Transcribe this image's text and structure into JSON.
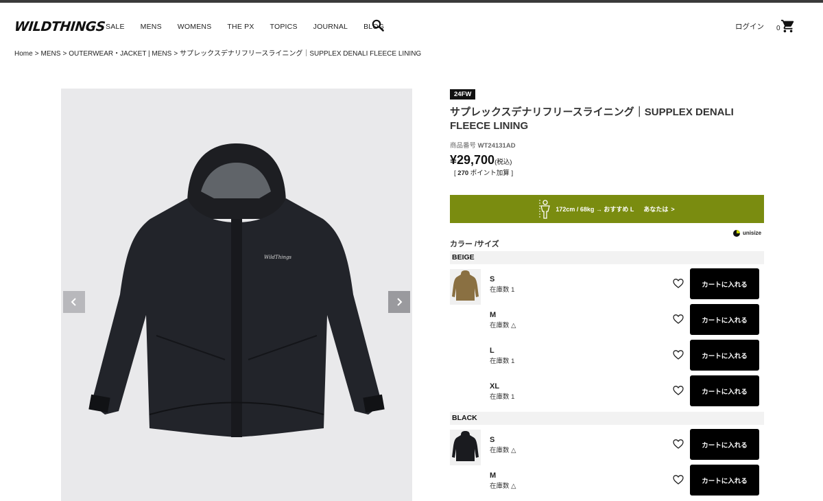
{
  "brand": {
    "logo_text": "WILDTHINGS"
  },
  "nav": [
    "SALE",
    "MENS",
    "WOMENS",
    "THE PX",
    "TOPICS",
    "JOURNAL",
    "BLOG"
  ],
  "header": {
    "login": "ログイン",
    "cart_count": "0"
  },
  "breadcrumb": [
    "Home",
    "MENS",
    "OUTERWEAR・JACKET | MENS",
    "サプレックスデナリフリースライニング｜SUPPLEX DENALI FLEECE LINING"
  ],
  "breadcrumb_sep": ">",
  "gallery": {
    "logo_on_jacket": "WildThings"
  },
  "product": {
    "season": "24FW",
    "title": "サプレックスデナリフリースライニング｜SUPPLEX DENALI FLEECE LINING",
    "code_label": "商品番号",
    "code": "WT24131AD",
    "price": "¥29,700",
    "tax": "(税込)",
    "points_open": "[",
    "points_value": "270",
    "points_label": "ポイント加算",
    "points_close": "]"
  },
  "size_recommend": {
    "text": "172cm / 68kg → おすすめ L",
    "you": "あなたは",
    "chevron": ">",
    "color": "#7a8c10"
  },
  "unisize": "unisize",
  "color_size_label": "カラー /サイズ",
  "colors": [
    {
      "name": "BEIGE",
      "swatch": "#8a7042",
      "sizes": [
        {
          "size": "S",
          "stock": "在庫数 1",
          "button": "カートに入れる"
        },
        {
          "size": "M",
          "stock": "在庫数 △",
          "button": "カートに入れる"
        },
        {
          "size": "L",
          "stock": "在庫数 1",
          "button": "カートに入れる"
        },
        {
          "size": "XL",
          "stock": "在庫数 1",
          "button": "カートに入れる"
        }
      ]
    },
    {
      "name": "BLACK",
      "swatch": "#1a1b1f",
      "sizes": [
        {
          "size": "S",
          "stock": "在庫数 △",
          "button": "カートに入れる"
        },
        {
          "size": "M",
          "stock": "在庫数 △",
          "button": "カートに入れる"
        }
      ]
    }
  ]
}
